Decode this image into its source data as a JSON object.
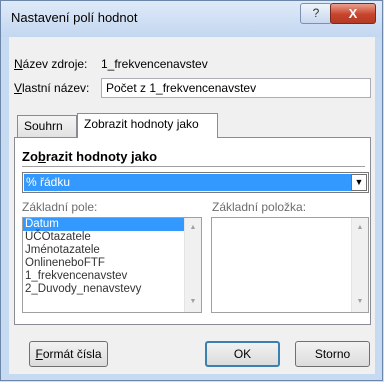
{
  "window": {
    "title": "Nastavení polí hodnot",
    "help_glyph": "?",
    "close_glyph": "X"
  },
  "source": {
    "label_prefix": "N",
    "label_rest": "ázev zdroje:",
    "value": "1_frekvencenavstev"
  },
  "custom_name": {
    "label_prefix": "V",
    "label_rest": "lastní název:",
    "value": "Počet z 1_frekvencenavstev"
  },
  "tabs": [
    {
      "label": "Souhrn",
      "active": false
    },
    {
      "label": "Zobrazit hodnoty jako",
      "active": true
    }
  ],
  "section": {
    "title_prefix": "Zo",
    "title_underlined": "b",
    "title_rest": "razit hodnoty jako"
  },
  "show_as": {
    "selected": "% řádku"
  },
  "base_field": {
    "label": "Základní pole:",
    "items": [
      "Datum",
      "UČOtazatele",
      "Jménotazatele",
      "OnlineneboFTF",
      "1_frekvencenavstev",
      "2_Duvody_nenavstevy"
    ],
    "selected_index": 0
  },
  "base_item": {
    "label": "Základní položka:",
    "items": []
  },
  "buttons": {
    "number_format_prefix": "F",
    "number_format_rest": "ormát čísla",
    "ok": "OK",
    "cancel": "Storno"
  }
}
